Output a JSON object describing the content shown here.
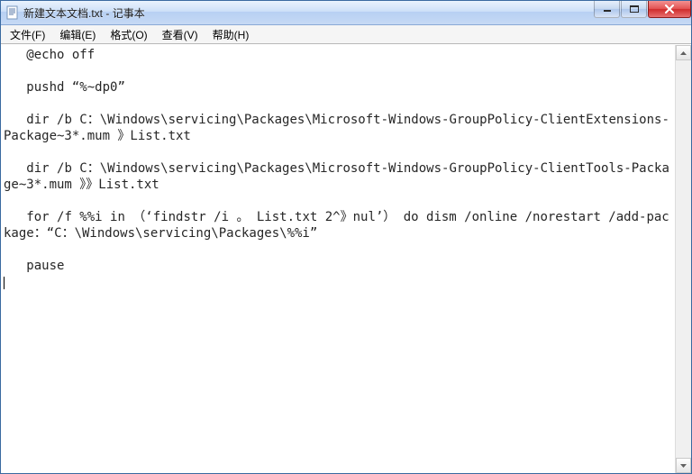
{
  "titlebar": {
    "doc_name": "新建文本文档.txt",
    "separator": " - ",
    "app_name": "记事本"
  },
  "menu": {
    "file": "文件(F)",
    "edit": "编辑(E)",
    "format": "格式(O)",
    "view": "查看(V)",
    "help": "帮助(H)"
  },
  "editor": {
    "content": "   @echo off\n\n   pushd “%~dp0”\n\n   dir /b C：\\Windows\\servicing\\Packages\\Microsoft-Windows-GroupPolicy-ClientExtensions-Package~3*.mum 》List.txt\n\n   dir /b C：\\Windows\\servicing\\Packages\\Microsoft-Windows-GroupPolicy-ClientTools-Package~3*.mum 》》List.txt\n\n   for /f %%i in （‘findstr /i 。 List.txt 2^》nul’） do dism /online /norestart /add-package：“C：\\Windows\\servicing\\Packages\\%%i”\n\n   pause\n"
  }
}
